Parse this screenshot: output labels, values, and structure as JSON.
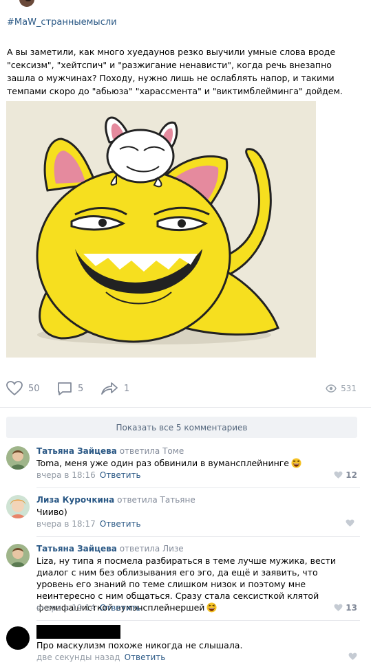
{
  "post": {
    "hashtag": "#MaW_странныемысли",
    "text": "А вы заметили, как много хуедаунов резко выучили умные слова вроде \"сексизм\", \"хейтспич\" и \"разжигание ненависти\", когда речь внезапно зашла о мужчинах? Походу, нужно лишь не ослаблять напор, и такими темпами скоро до \"абьюза\" \"харассмента\" и \"виктимблейминга\" дойдем."
  },
  "actions": {
    "likes": "50",
    "comments": "5",
    "shares": "1",
    "views": "531"
  },
  "show_all_comments": "Показать все 5 комментариев",
  "comments": [
    {
      "author": "Татьяна Зайцева",
      "reply_to": "ответила Томе",
      "text": "Toma, меня уже один раз обвинили в вумансплейнинге",
      "time": "вчера в 18:16",
      "reply_label": "Ответить",
      "likes": "12"
    },
    {
      "author": "Лиза Курочкина",
      "reply_to": "ответила Татьяне",
      "text": "Чииво)",
      "time": "вчера в 18:17",
      "reply_label": "Ответить",
      "likes": ""
    },
    {
      "author": "Татьяна Зайцева",
      "reply_to": "ответила Лизе",
      "text": "Liza, ну типа я посмела разбираться в теме лучше мужика, вести диалог с ним без облизывания его эго, да ещё и заявить, что уровень его знаний по теме слишком низок и поэтому мне неинтересно с ним общаться. Сразу стала сексисткой клятой фемифашисткой вумэнсплейнершей",
      "time": "вчера в 19:14",
      "reply_label": "Ответить",
      "likes": "13"
    },
    {
      "author": "",
      "reply_to": "",
      "text": "Про маскулизм похоже никогда не слышала.",
      "time": "две секунды назад",
      "reply_label": "Ответить",
      "likes": ""
    }
  ],
  "colors": {
    "link": "#2a5885",
    "muted": "#828a99",
    "cat_yellow": "#f7e22a",
    "button_bg": "#f0f2f5"
  }
}
